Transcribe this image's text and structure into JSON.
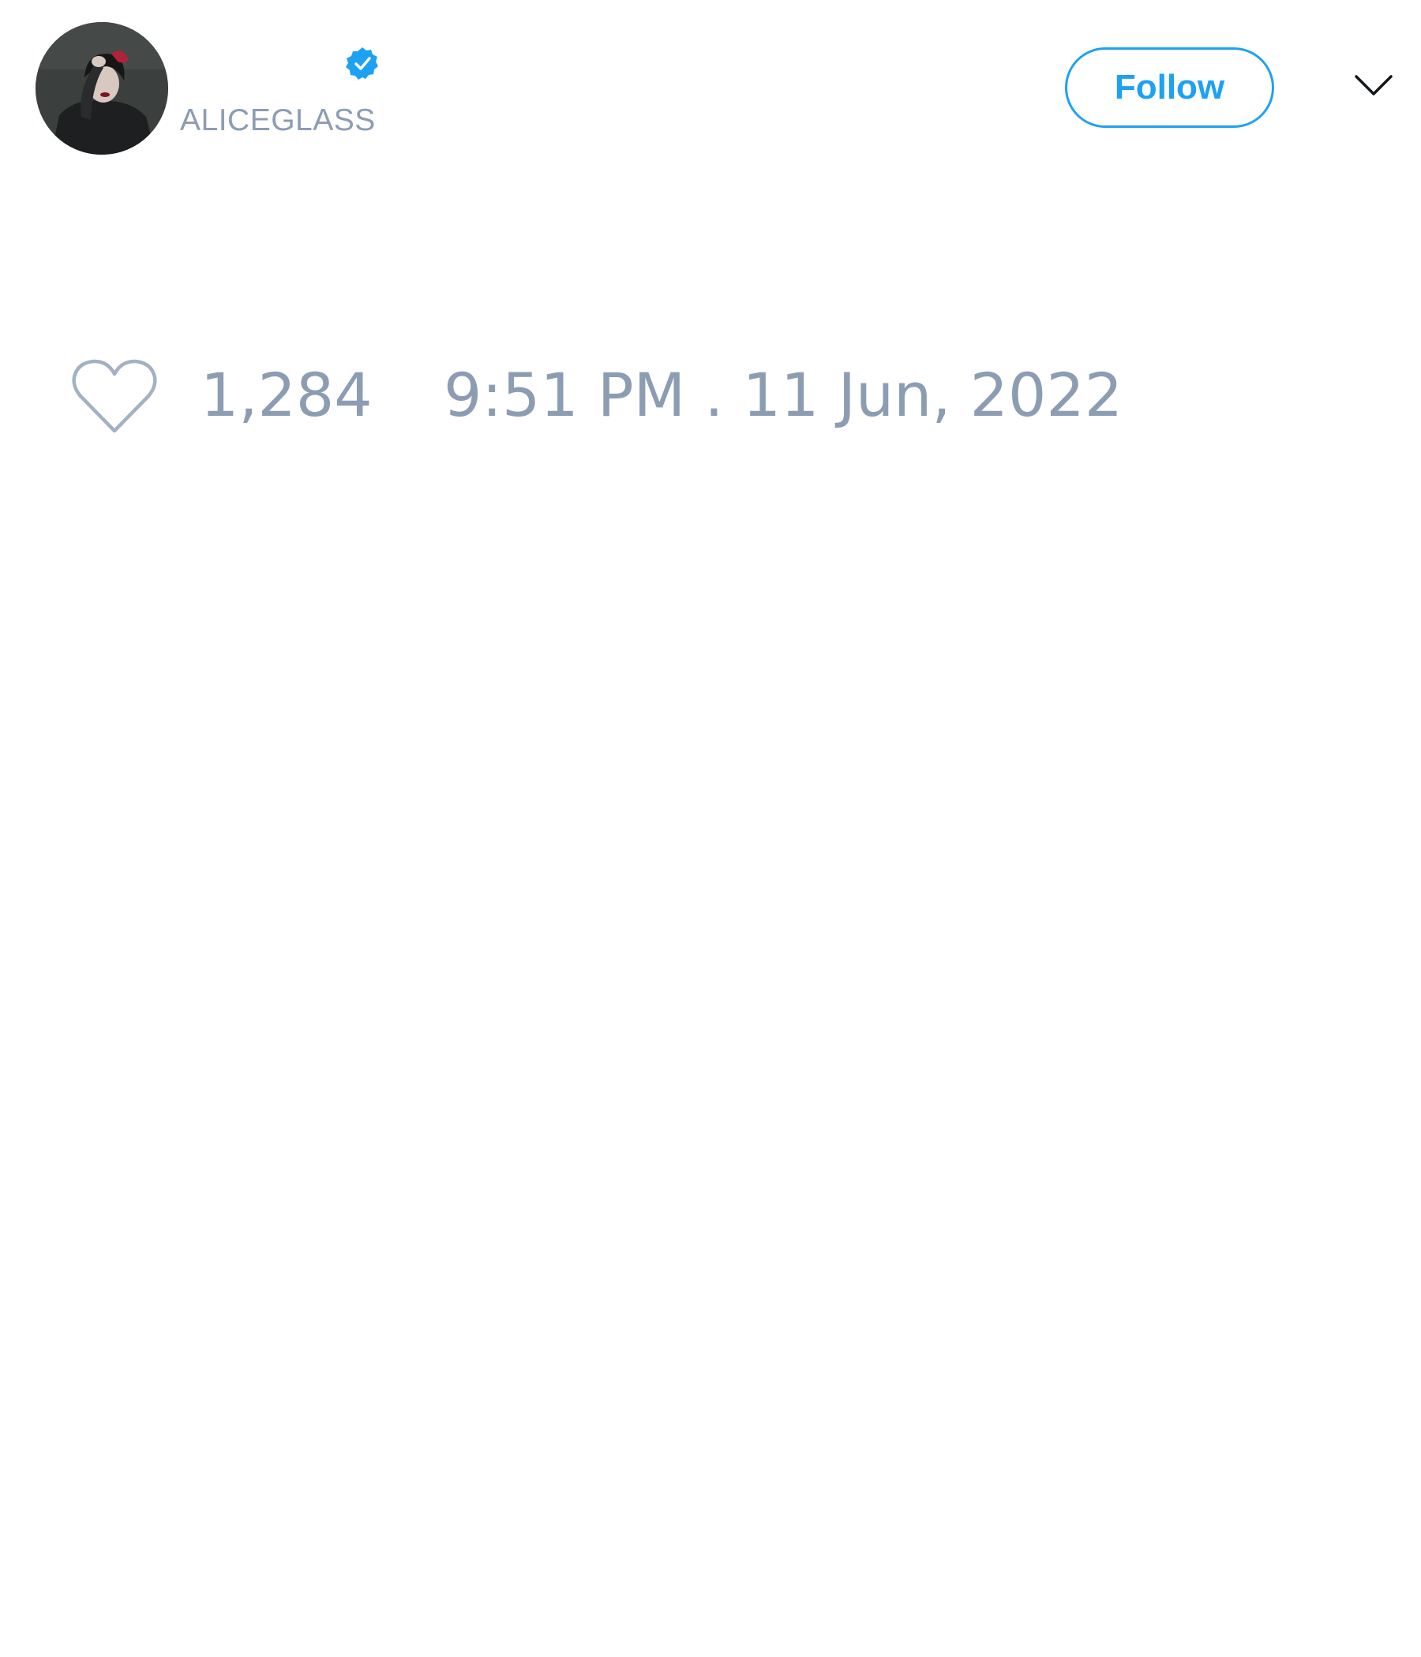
{
  "author": {
    "display_name": "",
    "handle": "ALICEGLASS",
    "verified": true,
    "avatar": "profile-photo"
  },
  "header": {
    "follow_label": "Follow",
    "menu_icon": "chevron-down-icon"
  },
  "engagement": {
    "like_icon": "heart-icon",
    "like_count": "1,284",
    "timestamp": "9:51 PM . 11 Jun, 2022"
  },
  "colors": {
    "accent": "#1da1f2",
    "muted_text": "#8c9db3",
    "background": "#ffffff"
  }
}
